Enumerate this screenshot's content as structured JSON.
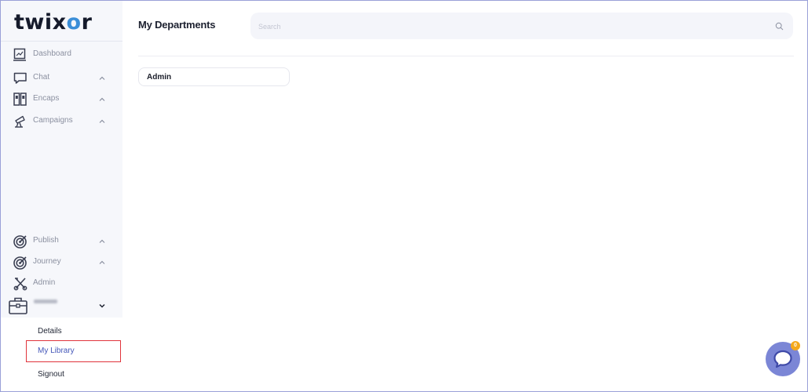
{
  "brand": {
    "logo_text_a": "twix",
    "logo_text_o": "o",
    "logo_text_b": "r"
  },
  "sidebar": {
    "items": [
      {
        "label": "Dashboard",
        "icon": "chart-monitor-icon",
        "expandable": false
      },
      {
        "label": "Chat",
        "icon": "chat-bubble-icon",
        "expandable": true
      },
      {
        "label": "Encaps",
        "icon": "binders-icon",
        "expandable": true
      },
      {
        "label": "Campaigns",
        "icon": "megaphone-icon",
        "expandable": true
      },
      {
        "label": "Publish",
        "icon": "target-icon",
        "expandable": true
      },
      {
        "label": "Journey",
        "icon": "target-icon",
        "expandable": true
      },
      {
        "label": "Admin",
        "icon": "tools-icon",
        "expandable": false
      }
    ],
    "department": {
      "icon": "briefcase-icon",
      "expanded": true
    },
    "sub_items": [
      {
        "label": "Details"
      },
      {
        "label": "My Library",
        "active": true
      },
      {
        "label": "Signout"
      }
    ]
  },
  "main": {
    "title": "My Departments",
    "search": {
      "placeholder": "Search",
      "icon": "search-icon"
    },
    "departments": [
      {
        "name": "Admin"
      }
    ]
  },
  "chat_widget": {
    "badge_count": "0",
    "icon": "chat-bubble-icon"
  },
  "colors": {
    "accent": "#4356b8",
    "sidebar_bg": "#f6f7fb",
    "active_border": "#e0343c",
    "fab": "#7b86d6",
    "badge": "#f5a91c"
  }
}
